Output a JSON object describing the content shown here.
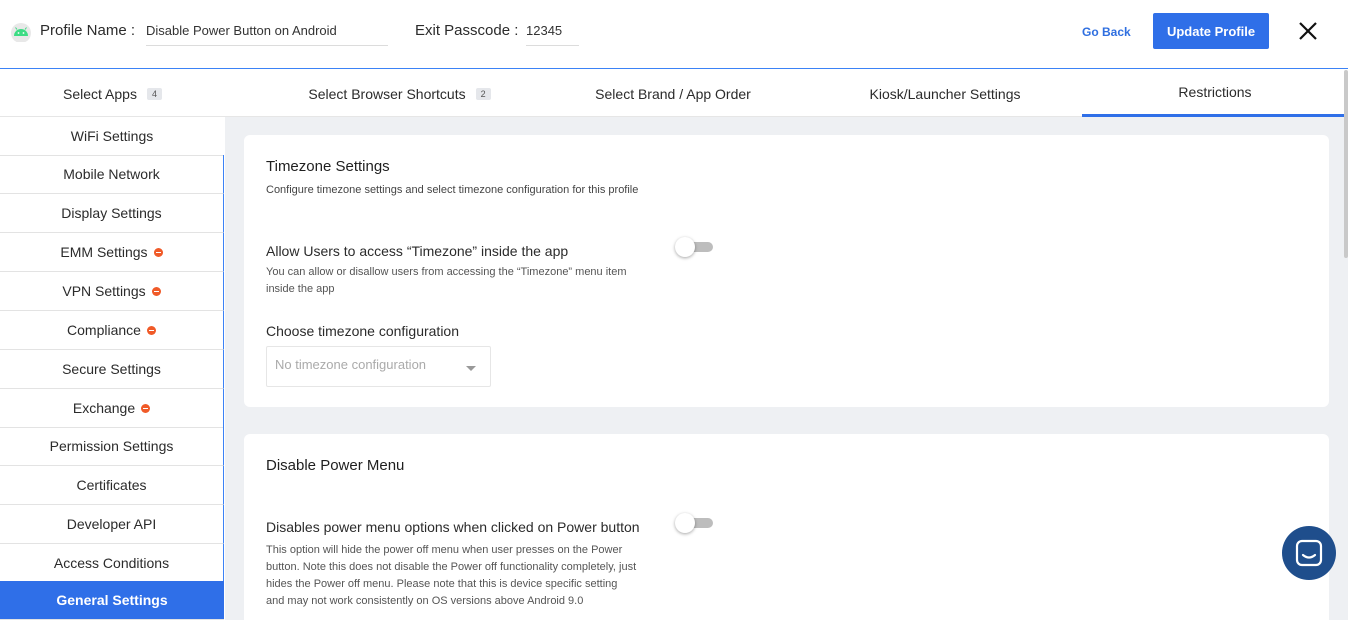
{
  "header": {
    "profile_label": "Profile Name :",
    "profile_value": "Disable Power Button on Android",
    "exit_label": "Exit Passcode :",
    "exit_value": "12345",
    "go_back": "Go Back",
    "update_button": "Update Profile"
  },
  "tabs": [
    {
      "label": "Select Apps",
      "badge": "4"
    },
    {
      "label": "Select Browser Shortcuts",
      "badge": "2"
    },
    {
      "label": "Select Brand / App Order"
    },
    {
      "label": "Kiosk/Launcher Settings"
    },
    {
      "label": "Restrictions",
      "active": true
    }
  ],
  "sidebar": {
    "items": [
      {
        "label": "WiFi Settings"
      },
      {
        "label": "Mobile Network"
      },
      {
        "label": "Display Settings"
      },
      {
        "label": "EMM Settings",
        "warning": true
      },
      {
        "label": "VPN Settings",
        "warning": true
      },
      {
        "label": "Compliance",
        "warning": true
      },
      {
        "label": "Secure Settings"
      },
      {
        "label": "Exchange",
        "warning": true
      },
      {
        "label": "Permission Settings"
      },
      {
        "label": "Certificates"
      },
      {
        "label": "Developer API"
      },
      {
        "label": "Access Conditions"
      },
      {
        "label": "General Settings",
        "active": true
      }
    ]
  },
  "timezone": {
    "title": "Timezone Settings",
    "subtitle": "Configure timezone settings and select timezone configuration for this profile",
    "option_title": "Allow Users to access “Timezone” inside the app",
    "option_desc": "You can allow or disallow users from accessing the “Timezone” menu item inside the app",
    "toggle_on": false,
    "choose_label": "Choose timezone configuration",
    "select_value": "No timezone configuration"
  },
  "power": {
    "title": "Disable Power Menu",
    "option_title": "Disables power menu options when clicked on Power button",
    "option_desc": "This option will hide the power off menu when user presses on the Power button. Note this does not disable the Power off functionality completely, just hides the Power off menu. Please note that this is device specific setting and may not work consistently on OS versions above Android 9.0",
    "toggle_on": false
  },
  "colors": {
    "accent": "#2f6fe8",
    "warning": "#f05a28",
    "android": "#3ddc84",
    "chat": "#1f4e8c"
  },
  "icons": {
    "logo": "android-icon",
    "close": "close-icon",
    "chat": "chat-icon",
    "select": "chevron-down-icon"
  }
}
